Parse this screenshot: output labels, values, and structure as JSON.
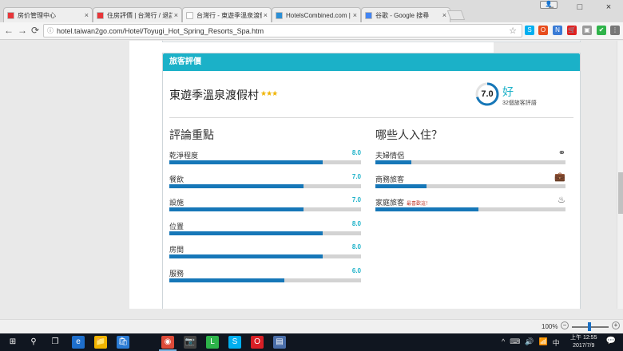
{
  "browser": {
    "tabs": [
      {
        "title": "房价管理中心",
        "favicon_color": "#e8363a",
        "active": false
      },
      {
        "title": "住房評價 | 台灣行 / 退訂...",
        "favicon_color": "#e8363a",
        "active": false
      },
      {
        "title": "台灣行 - 東遊季溫泉渡假村",
        "favicon_color": "#ffffff",
        "active": true
      },
      {
        "title": "HotelsCombined.com |",
        "favicon_color": "#2b8fd6",
        "active": false
      },
      {
        "title": "谷歌 - Google 搜尋",
        "favicon_color": "#4285f4",
        "active": false
      }
    ],
    "tab_close_glyph": "×",
    "window_controls": {
      "minimize": "–",
      "maximize": "□",
      "close": "×"
    },
    "nav": {
      "back": "←",
      "forward": "→",
      "reload": "⟳"
    },
    "url": "hotel.taiwan2go.com/Hotel/Toyugi_Hot_Spring_Resorts_Spa.htm",
    "info_glyph": "ⓘ",
    "star_glyph": "☆",
    "extensions": [
      {
        "name": "skype-icon",
        "color": "#00aff0",
        "glyph": "S"
      },
      {
        "name": "office-icon",
        "color": "#e74c1c",
        "glyph": "O"
      },
      {
        "name": "new-icon",
        "color": "#3a7bd5",
        "glyph": "N"
      },
      {
        "name": "cart-icon",
        "color": "#e02020",
        "glyph": "🛒"
      },
      {
        "name": "extension-icon",
        "color": "#9a9a9a",
        "glyph": "▣"
      },
      {
        "name": "check-icon",
        "color": "#2fb34a",
        "glyph": "✔"
      },
      {
        "name": "menu-icon",
        "color": "#777777",
        "glyph": "⋮"
      }
    ]
  },
  "review": {
    "section_header": "旅客評價",
    "hotel_name": "東遊季溫泉渡假村",
    "hotel_stars": "★★★",
    "score": "7.0",
    "score_word": "好",
    "review_count_text": "32個旅客評語",
    "score_fraction": 0.7,
    "ratings_title": "評論重點",
    "ratings": [
      {
        "label": "乾淨程度",
        "value": "8.0",
        "fraction": 0.8
      },
      {
        "label": "餐飲",
        "value": "7.0",
        "fraction": 0.7
      },
      {
        "label": "設施",
        "value": "7.0",
        "fraction": 0.7
      },
      {
        "label": "位置",
        "value": "8.0",
        "fraction": 0.8
      },
      {
        "label": "房間",
        "value": "8.0",
        "fraction": 0.8
      },
      {
        "label": "服務",
        "value": "6.0",
        "fraction": 0.6
      }
    ],
    "who_title": "哪些人入住？",
    "who": [
      {
        "label": "夫婦情侶",
        "hint": "",
        "icon": "⚭",
        "fraction": 0.19
      },
      {
        "label": "商務旅客",
        "hint": "",
        "icon": "💼",
        "fraction": 0.27
      },
      {
        "label": "家庭旅客",
        "hint": "最喜歡這！",
        "icon": "♨",
        "fraction": 0.54
      }
    ]
  },
  "statusbar": {
    "zoom": "100%",
    "zoom_minus": "−",
    "zoom_plus": "+"
  },
  "taskbar": {
    "start_glyph": "⊞",
    "search_glyph": "⚲",
    "apps": [
      {
        "name": "task-view-icon",
        "glyph": "❐",
        "color": "#101620"
      },
      {
        "name": "edge-icon",
        "glyph": "e",
        "color": "#1e6fcc"
      },
      {
        "name": "file-explorer-icon",
        "glyph": "📁",
        "color": "#f0b400"
      },
      {
        "name": "store-icon",
        "glyph": "🛍",
        "color": "#2a7bd4"
      },
      {
        "name": "chrome-icon",
        "glyph": "◉",
        "color": "#dd4b39"
      },
      {
        "name": "camera-icon",
        "glyph": "📷",
        "color": "#444444"
      },
      {
        "name": "line-icon",
        "glyph": "L",
        "color": "#2db34a"
      },
      {
        "name": "skype-icon",
        "glyph": "S",
        "color": "#00aff0"
      },
      {
        "name": "opera-icon",
        "glyph": "O",
        "color": "#d81f26"
      },
      {
        "name": "app-icon",
        "glyph": "▤",
        "color": "#4a6ea9"
      }
    ],
    "tray_icons": [
      "^",
      "⌨",
      "🔊",
      "📶",
      "中"
    ],
    "clock_time": "上午 12:55",
    "clock_date": "2017/7/9",
    "notification_glyph": "💬"
  }
}
